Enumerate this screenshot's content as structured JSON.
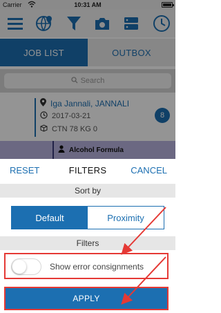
{
  "status_bar": {
    "carrier": "Carrier",
    "time": "10:31 AM"
  },
  "toolbar": {
    "icons": [
      "menu-icon",
      "globe-location-icon",
      "filter-icon",
      "camera-icon",
      "server-icon",
      "clock-icon"
    ]
  },
  "tabs": [
    {
      "label": "JOB LIST",
      "active": true
    },
    {
      "label": "OUTBOX",
      "active": false
    }
  ],
  "search": {
    "placeholder": "Search"
  },
  "job_card": {
    "name": "Iga Jannali, JANNALI",
    "date": "2017-03-21",
    "details": "CTN 78 KG 0",
    "count": "8"
  },
  "job_card_2": {
    "name": "Alcohol Formula"
  },
  "filter_sheet": {
    "reset_label": "RESET",
    "title": "FILTERS",
    "cancel_label": "CANCEL",
    "sort_by_label": "Sort by",
    "sort_options": [
      {
        "label": "Default",
        "selected": true
      },
      {
        "label": "Proximity",
        "selected": false
      }
    ],
    "filters_label": "Filters",
    "show_errors_label": "Show error consignments",
    "show_errors_on": false,
    "apply_label": "APPLY"
  },
  "colors": {
    "primary": "#1c6fb1",
    "annotation": "#e53935",
    "section_bg": "#e6e6e6"
  }
}
